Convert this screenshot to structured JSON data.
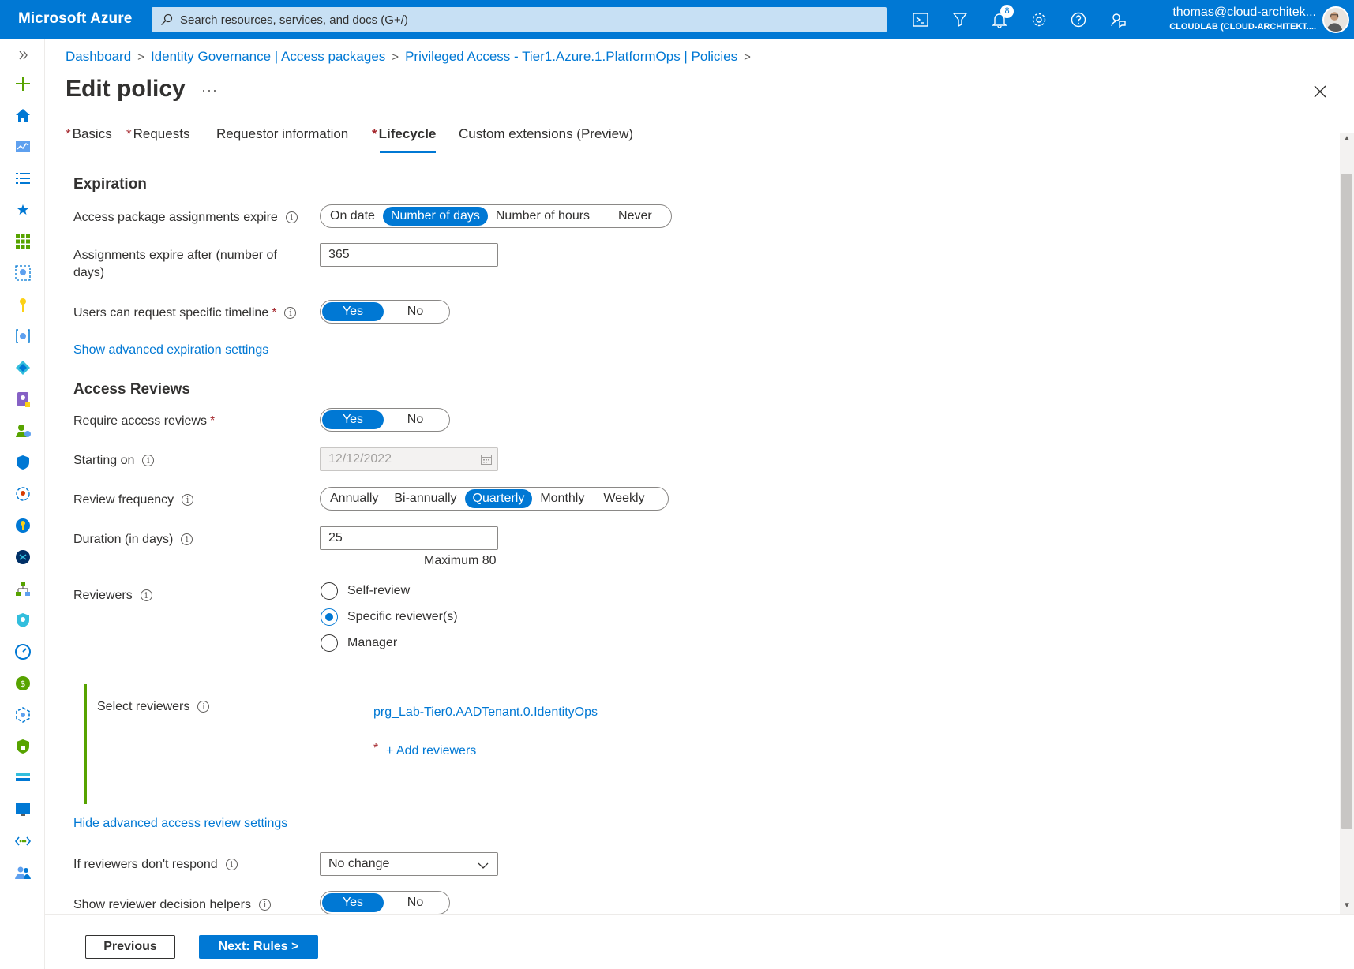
{
  "topbar": {
    "brand": "Microsoft Azure",
    "search_placeholder": "Search resources, services, and docs (G+/)",
    "notification_count": "8",
    "user_email": "thomas@cloud-architek...",
    "user_tenant": "CLOUDLAB (CLOUD-ARCHITEKT...."
  },
  "breadcrumb": [
    "Dashboard",
    "Identity Governance | Access packages",
    "Privileged Access - Tier1.Azure.1.PlatformOps | Policies"
  ],
  "page": {
    "title": "Edit policy",
    "more": "···"
  },
  "tabs": [
    {
      "label": "Basics",
      "required": "*"
    },
    {
      "label": "Requests",
      "required": "*"
    },
    {
      "label": "Requestor information",
      "required": ""
    },
    {
      "label": "Lifecycle",
      "required": "*"
    },
    {
      "label": "Custom extensions (Preview)",
      "required": ""
    }
  ],
  "expiration": {
    "title": "Expiration",
    "assignments_expire_label": "Access package assignments expire",
    "expire_options": [
      "On date",
      "Number of days",
      "Number of hours",
      "Never"
    ],
    "expire_selected": "Number of days",
    "expire_after_label": "Assignments expire after (number of days)",
    "expire_after_value": "365",
    "timeline_label": "Users can request specific timeline",
    "timeline_yes": "Yes",
    "timeline_no": "No",
    "advanced_link": "Show advanced expiration settings"
  },
  "reviews": {
    "title": "Access Reviews",
    "require_label": "Require access reviews",
    "require_yes": "Yes",
    "require_no": "No",
    "starting_label": "Starting on",
    "starting_value": "12/12/2022",
    "frequency_label": "Review frequency",
    "frequency_options": [
      "Annually",
      "Bi-annually",
      "Quarterly",
      "Monthly",
      "Weekly"
    ],
    "frequency_selected": "Quarterly",
    "duration_label": "Duration (in days)",
    "duration_value": "25",
    "duration_max": "Maximum 80",
    "reviewers_label": "Reviewers",
    "reviewer_options": [
      "Self-review",
      "Specific reviewer(s)",
      "Manager"
    ],
    "reviewer_selected": "Specific reviewer(s)",
    "select_reviewers_label": "Select reviewers",
    "selected_reviewer": "prg_Lab-Tier0.AADTenant.0.IdentityOps",
    "add_reviewers": "+ Add reviewers",
    "hide_advanced_link": "Hide advanced access review settings",
    "no_respond_label": "If reviewers don't respond",
    "no_respond_value": "No change",
    "helpers_label": "Show reviewer decision helpers",
    "helpers_yes": "Yes",
    "helpers_no": "No"
  },
  "footer": {
    "previous": "Previous",
    "next": "Next: Rules >"
  },
  "colors": {
    "accent": "#0078d4",
    "required": "#a4262c",
    "green_bar": "#57a300"
  }
}
